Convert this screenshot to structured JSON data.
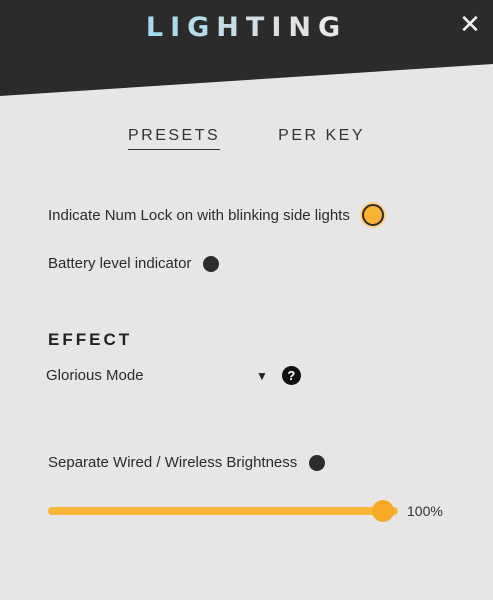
{
  "header": {
    "title_letters": [
      "L",
      "I",
      "G",
      "H",
      "T",
      "I",
      "N",
      "G"
    ],
    "title_colors": [
      "#a5dcef",
      "#aadced",
      "#b7dcea",
      "#c4dde6",
      "#d1dee3",
      "#dcdfe0",
      "#e2e2e2",
      "#e8e8e8"
    ],
    "close_glyph": "✕"
  },
  "tabs": [
    {
      "label": "PRESETS",
      "active": true
    },
    {
      "label": "PER KEY",
      "active": false
    }
  ],
  "options": {
    "num_lock_label": "Indicate Num Lock on with blinking side lights",
    "num_lock_on": true,
    "battery_label": "Battery level indicator",
    "battery_on": false
  },
  "effect": {
    "section_title": "EFFECT",
    "selected": "Glorious Mode",
    "help_glyph": "?"
  },
  "brightness": {
    "label": "Separate Wired / Wireless Brightness",
    "separate_on": false,
    "value": 100,
    "value_label": "100%"
  },
  "colors": {
    "header_bg": "#2b2b2b",
    "body_bg": "#e6e6e6",
    "accent": "#f7b539"
  }
}
